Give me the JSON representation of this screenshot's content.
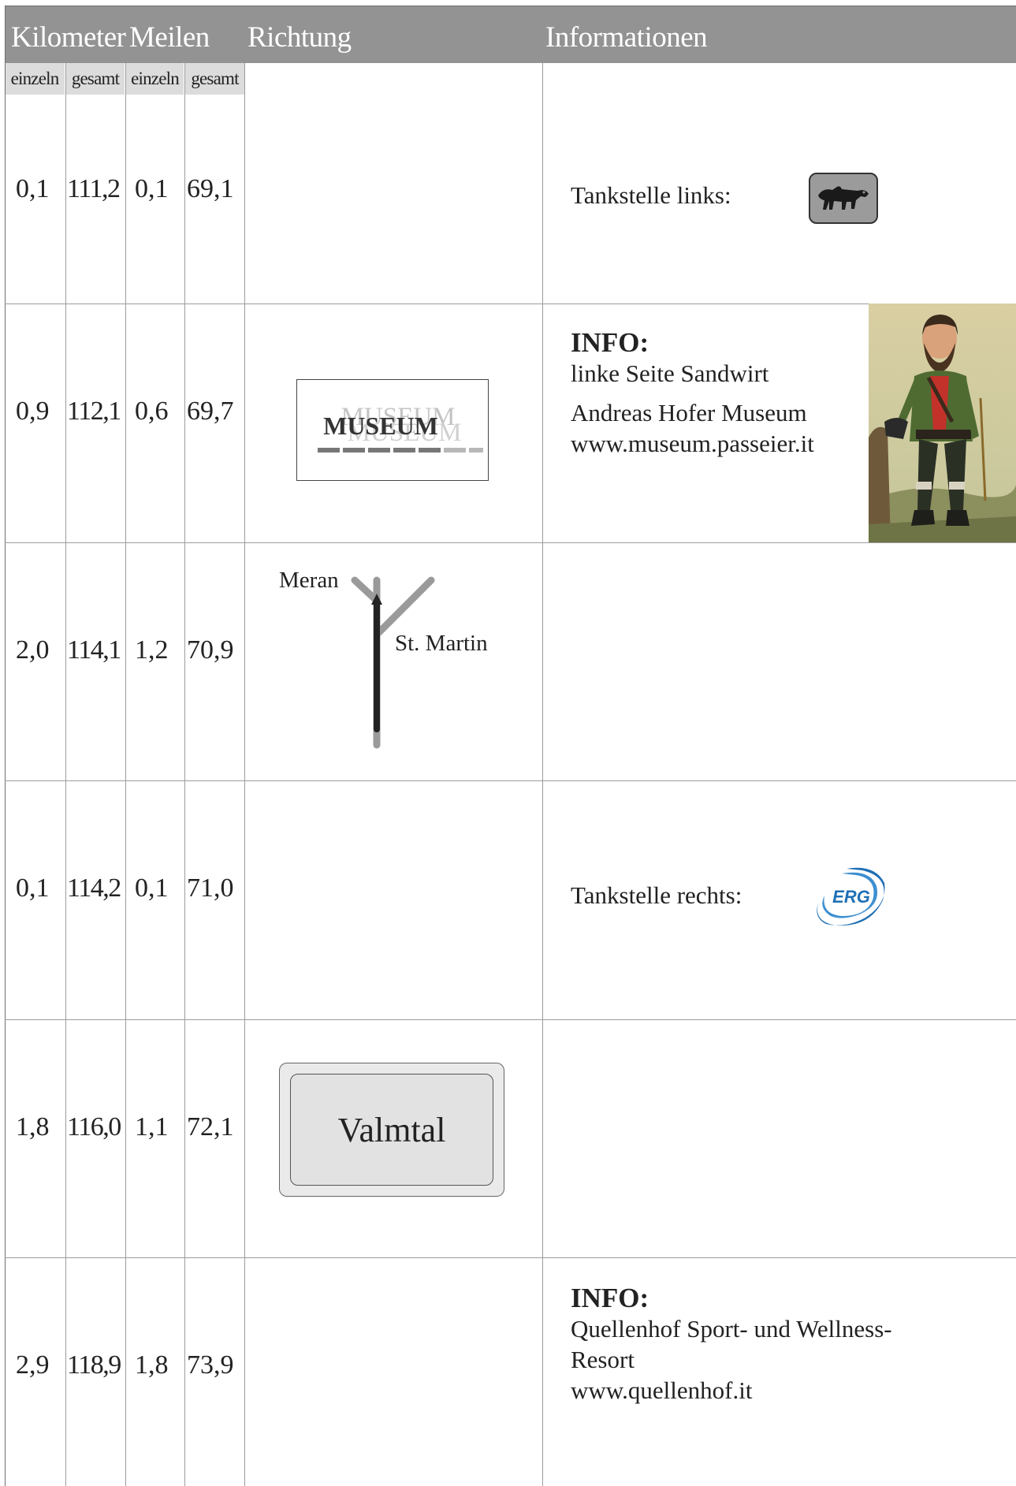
{
  "header": {
    "km": "Kilometer",
    "miles": "Meilen",
    "direction": "Richtung",
    "info": "Informationen"
  },
  "subheader": {
    "single1": "einzeln",
    "total1": "gesamt",
    "single2": "einzeln",
    "total2": "gesamt"
  },
  "rows": [
    {
      "km_single": "0,1",
      "km_total": "111,2",
      "mi_single": "0,1",
      "mi_total": "69,1"
    },
    {
      "km_single": "0,9",
      "km_total": "112,1",
      "mi_single": "0,6",
      "mi_total": "69,7"
    },
    {
      "km_single": "2,0",
      "km_total": "114,1",
      "mi_single": "1,2",
      "mi_total": "70,9"
    },
    {
      "km_single": "0,1",
      "km_total": "114,2",
      "mi_single": "0,1",
      "mi_total": "71,0"
    },
    {
      "km_single": "1,8",
      "km_total": "116,0",
      "mi_single": "1,1",
      "mi_total": "72,1"
    },
    {
      "km_single": "2,9",
      "km_total": "118,9",
      "mi_single": "1,8",
      "mi_total": "73,9"
    }
  ],
  "info": {
    "row1": {
      "text": "Tankstelle links:",
      "logo": "eni-six-legged-dog-logo"
    },
    "row2": {
      "title": "INFO:",
      "line1": "linke Seite Sandwirt",
      "line2": "Andreas Hofer Museum",
      "line3": "www.museum.passeier.it",
      "image": "andreas-hofer-portrait"
    },
    "row4": {
      "text": "Tankstelle rechts:",
      "logo": "erg-logo",
      "logo_text": "ERG"
    },
    "row6": {
      "title": "INFO:",
      "line1": "Quellenhof Sport- und Wellness-",
      "line2": "Resort",
      "line3": "www.quellenhof.it"
    }
  },
  "direction": {
    "museum_sign": "MUSEUM",
    "junction_left": "Meran",
    "junction_right": "St. Martin",
    "valmtal_sign": "Valmtal"
  },
  "colors": {
    "header_bg": "#939394",
    "subheader_bg": "#dcdcdd",
    "grid_line": "#9c9c9c",
    "route_dark": "#222222",
    "route_light": "#9a9a9a",
    "erg_blue": "#1f6fb5"
  }
}
